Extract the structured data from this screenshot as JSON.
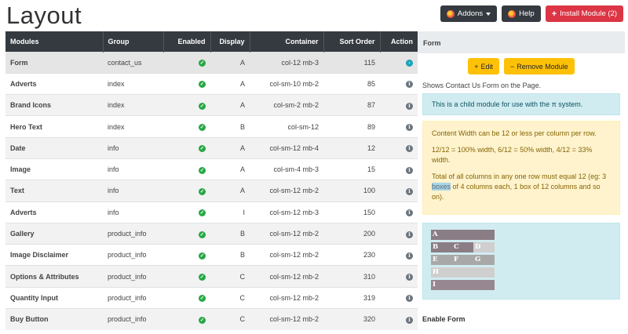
{
  "page": {
    "title": "Layout"
  },
  "toolbar": {
    "addons_label": "Addons",
    "help_label": "Help",
    "install_label": "Install Module (2)"
  },
  "table": {
    "headers": [
      "Modules",
      "Group",
      "Enabled",
      "Display",
      "Container",
      "Sort Order",
      "Action"
    ],
    "rows": [
      {
        "name": "Form",
        "group": "contact_us",
        "display": "A",
        "container": "col-12 mb-3",
        "sort": "115",
        "active": true
      },
      {
        "name": "Adverts",
        "group": "index",
        "display": "A",
        "container": "col-sm-10 mb-2",
        "sort": "85"
      },
      {
        "name": "Brand Icons",
        "group": "index",
        "display": "A",
        "container": "col-sm-2 mb-2",
        "sort": "87"
      },
      {
        "name": "Hero Text",
        "group": "index",
        "display": "B",
        "container": "col-sm-12",
        "sort": "89"
      },
      {
        "name": "Date",
        "group": "info",
        "display": "A",
        "container": "col-sm-12 mb-4",
        "sort": "12"
      },
      {
        "name": "Image",
        "group": "info",
        "display": "A",
        "container": "col-sm-4 mb-3",
        "sort": "15"
      },
      {
        "name": "Text",
        "group": "info",
        "display": "A",
        "container": "col-sm-12 mb-2",
        "sort": "100"
      },
      {
        "name": "Adverts",
        "group": "info",
        "display": "I",
        "container": "col-sm-12 mb-3",
        "sort": "150"
      },
      {
        "name": "Gallery",
        "group": "product_info",
        "display": "B",
        "container": "col-sm-12 mb-2",
        "sort": "200"
      },
      {
        "name": "Image Disclaimer",
        "group": "product_info",
        "display": "B",
        "container": "col-sm-12 mb-2",
        "sort": "230"
      },
      {
        "name": "Options & Attributes",
        "group": "product_info",
        "display": "C",
        "container": "col-sm-12 mb-2",
        "sort": "310"
      },
      {
        "name": "Quantity Input",
        "group": "product_info",
        "display": "C",
        "container": "col-sm-12 mb-2",
        "sort": "319"
      },
      {
        "name": "Buy Button",
        "group": "product_info",
        "display": "C",
        "container": "col-sm-12 mb-2",
        "sort": "320"
      }
    ]
  },
  "panel": {
    "title": "Form",
    "edit_label": "Edit",
    "remove_label": "Remove Module",
    "description": "Shows Contact Us Form on the Page.",
    "info_alert": "This is a child module for use with the π system.",
    "warn_p1": "Content Width can be 12 or less per column per row.",
    "warn_p2": "12/12 = 100% width, 6/12 = 50% width, 4/12 = 33% width.",
    "warn_p3_a": "Total of all columns in any one row must equal 12 (eg: 3 ",
    "warn_p3_hl": "boxes",
    "warn_p3_b": " of 4 columns each, 1 box of 12 columns and so on).",
    "grid_rows": [
      [
        {
          "label": "A",
          "color": "dark"
        }
      ],
      [
        {
          "label": "B",
          "color": "dark"
        },
        {
          "label": "C",
          "color": "dark"
        },
        {
          "label": "D",
          "color": "light"
        }
      ],
      [
        {
          "label": "E",
          "color": "gray"
        },
        {
          "label": "F",
          "color": "gray"
        },
        {
          "label": "G",
          "color": "gray"
        }
      ],
      [
        {
          "label": "H",
          "color": "light"
        }
      ],
      [
        {
          "label": "I",
          "color": "mauve"
        }
      ]
    ],
    "enable_label": "Enable Form"
  },
  "icons": {
    "enabled": "check-circle-icon",
    "action": "info-circle-icon"
  },
  "colors": {
    "header_bg": "#343a40",
    "danger": "#dc3545",
    "warning": "#ffc107",
    "success": "#28a745",
    "info": "#17a2b8"
  }
}
